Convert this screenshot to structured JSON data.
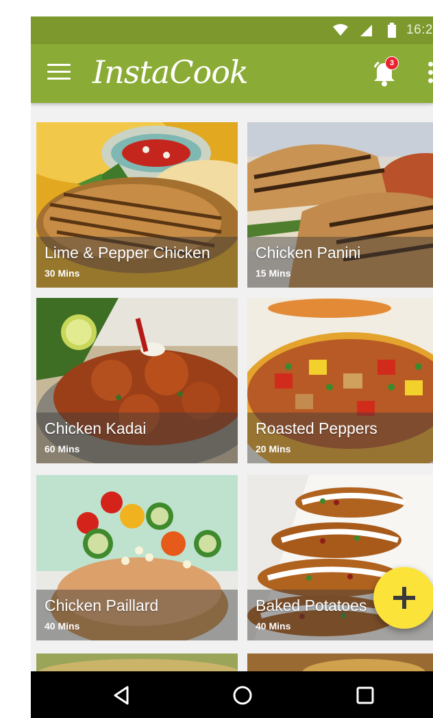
{
  "status_bar": {
    "time": "16:2",
    "icons": [
      "wifi-icon",
      "signal-icon",
      "battery-icon"
    ],
    "background": "#7d992d"
  },
  "app_bar": {
    "title": "InstaCook",
    "notification_count": "3",
    "background": "#8aab35",
    "icons": [
      "menu-icon",
      "bell-icon",
      "more-vert-icon"
    ]
  },
  "recipes": [
    {
      "name": "Lime & Pepper Chicken",
      "time": "30 Mins"
    },
    {
      "name": "Chicken Panini",
      "time": "15 Mins"
    },
    {
      "name": "Chicken Kadai",
      "time": "60 Mins"
    },
    {
      "name": "Roasted Peppers",
      "time": "20 Mins"
    },
    {
      "name": "Chicken Paillard",
      "time": "40 Mins"
    },
    {
      "name": "Baked Potatoes",
      "time": "40 Mins"
    }
  ],
  "fab": {
    "icon": "plus-icon",
    "color": "#fce33a"
  },
  "nav_bar": {
    "buttons": [
      "back-icon",
      "home-icon",
      "recents-icon"
    ]
  }
}
